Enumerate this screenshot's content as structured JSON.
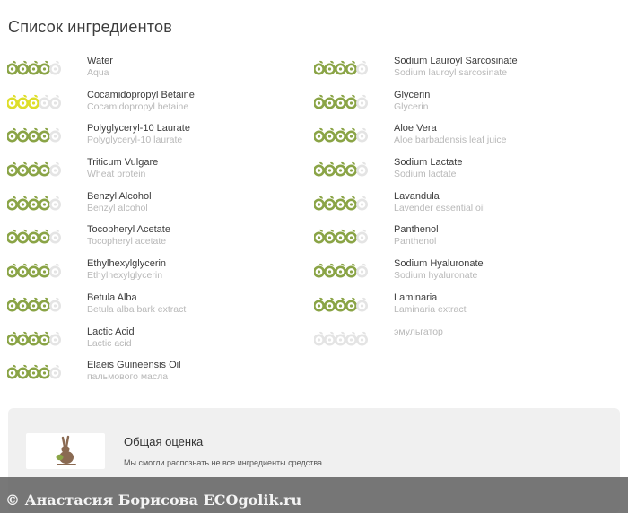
{
  "page": {
    "title": "Список ингредиентов"
  },
  "colors": {
    "good": "#8aa446",
    "moderate": "#dede2a",
    "empty": "#e4e4e4"
  },
  "ingredients_left": [
    {
      "name": "Water",
      "alias": "Aqua",
      "rating": 4
    },
    {
      "name": "Cocamidopropyl Betaine",
      "alias": "Cocamidopropyl betaine",
      "rating": 3
    },
    {
      "name": "Polyglyceryl-10 Laurate",
      "alias": "Polyglyceryl-10 laurate",
      "rating": 4
    },
    {
      "name": "Triticum Vulgare",
      "alias": "Wheat protein",
      "rating": 4
    },
    {
      "name": "Benzyl Alcohol",
      "alias": "Benzyl alcohol",
      "rating": 4
    },
    {
      "name": "Tocopheryl Acetate",
      "alias": "Tocopheryl acetate",
      "rating": 4
    },
    {
      "name": "Ethylhexylglycerin",
      "alias": "Ethylhexylglycerin",
      "rating": 4
    },
    {
      "name": "Betula Alba",
      "alias": "Betula alba bark extract",
      "rating": 4
    },
    {
      "name": "Lactic Acid",
      "alias": "Lactic acid",
      "rating": 4
    },
    {
      "name": "Elaeis Guineensis Oil",
      "alias": "пальмового масла",
      "rating": 4
    }
  ],
  "ingredients_right": [
    {
      "name": "Sodium Lauroyl Sarcosinate",
      "alias": "Sodium lauroyl sarcosinate",
      "rating": 4
    },
    {
      "name": "Glycerin",
      "alias": "Glycerin",
      "rating": 4
    },
    {
      "name": "Aloe Vera",
      "alias": "Aloe barbadensis leaf juice",
      "rating": 4
    },
    {
      "name": "Sodium Lactate",
      "alias": "Sodium lactate",
      "rating": 4
    },
    {
      "name": "Lavandula",
      "alias": "Lavender essential oil",
      "rating": 4
    },
    {
      "name": "Panthenol",
      "alias": "Panthenol",
      "rating": 4
    },
    {
      "name": "Sodium Hyaluronate",
      "alias": "Sodium hyaluronate",
      "rating": 4
    },
    {
      "name": "Laminaria",
      "alias": "Laminaria extract",
      "rating": 4
    },
    {
      "name": "",
      "alias": "эмульгатор",
      "rating": 0
    }
  ],
  "summary": {
    "title": "Общая оценка",
    "text": "Мы смогли распознать не все ингредиенты средства."
  },
  "watermark": {
    "text": "© Анастасия Борисова ECOgolik.ru"
  }
}
